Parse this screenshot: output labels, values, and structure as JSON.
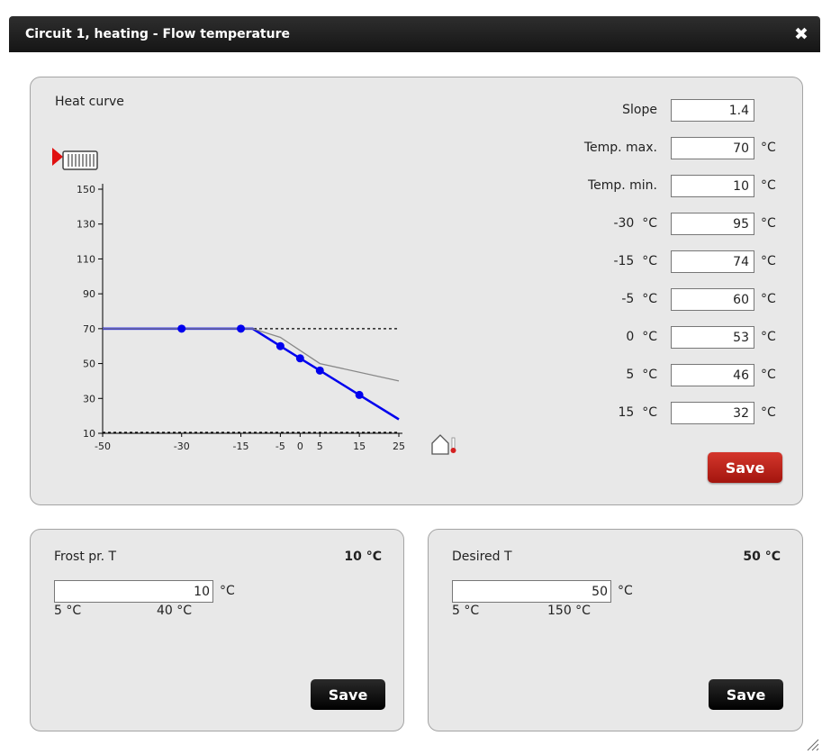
{
  "dialog": {
    "title": "Circuit 1, heating - Flow temperature",
    "close_icon": "close-icon"
  },
  "heat_curve": {
    "title": "Heat curve",
    "params": [
      {
        "label": "Slope",
        "value": "1.4",
        "unit": ""
      },
      {
        "label": "Temp. max.",
        "value": "70",
        "unit": "°C"
      },
      {
        "label": "Temp. min.",
        "value": "10",
        "unit": "°C"
      },
      {
        "label": "-30  °C",
        "value": "95",
        "unit": "°C"
      },
      {
        "label": "-15  °C",
        "value": "74",
        "unit": "°C"
      },
      {
        "label": "-5  °C",
        "value": "60",
        "unit": "°C"
      },
      {
        "label": "0  °C",
        "value": "53",
        "unit": "°C"
      },
      {
        "label": "5  °C",
        "value": "46",
        "unit": "°C"
      },
      {
        "label": "15  °C",
        "value": "32",
        "unit": "°C"
      }
    ],
    "save_label": "Save"
  },
  "frost": {
    "title": "Frost pr. T",
    "value_display": "10 °C",
    "input_value": "10",
    "unit": "°C",
    "min_label": "5 °C",
    "max_label": "40 °C",
    "save_label": "Save"
  },
  "desired": {
    "title": "Desired T",
    "value_display": "50 °C",
    "input_value": "50",
    "unit": "°C",
    "min_label": "5 °C",
    "max_label": "150 °C",
    "save_label": "Save"
  },
  "colors": {
    "curve": "#0000ee",
    "reference_curve": "#888888",
    "save_red": "#c0241b",
    "save_black": "#111111",
    "title_bar": "#1e1e1e"
  },
  "chart_data": {
    "type": "line",
    "title": "",
    "xlabel": "",
    "ylabel": "",
    "x_ticks": [
      -50,
      -30,
      -15,
      -5,
      0,
      5,
      15,
      25
    ],
    "y_ticks": [
      10,
      30,
      50,
      70,
      90,
      110,
      130,
      150
    ],
    "xlim": [
      -50,
      25
    ],
    "ylim": [
      10,
      150
    ],
    "limits": {
      "max": 70,
      "min": 10
    },
    "series": [
      {
        "role": "active",
        "x": [
          -50,
          -30,
          -15,
          -12,
          -5,
          0,
          5,
          15,
          25
        ],
        "y": [
          70,
          70,
          70,
          70,
          60,
          53,
          46,
          32,
          18
        ],
        "points_x": [
          -30,
          -15,
          -5,
          0,
          5,
          15
        ],
        "points_y": [
          70,
          70,
          60,
          53,
          46,
          32
        ]
      },
      {
        "role": "reference",
        "x": [
          -50,
          -12,
          -5,
          5,
          25
        ],
        "y": [
          70,
          70,
          65,
          50,
          40
        ]
      }
    ],
    "icons": [
      "radiator-icon",
      "house-temperature-icon"
    ]
  }
}
